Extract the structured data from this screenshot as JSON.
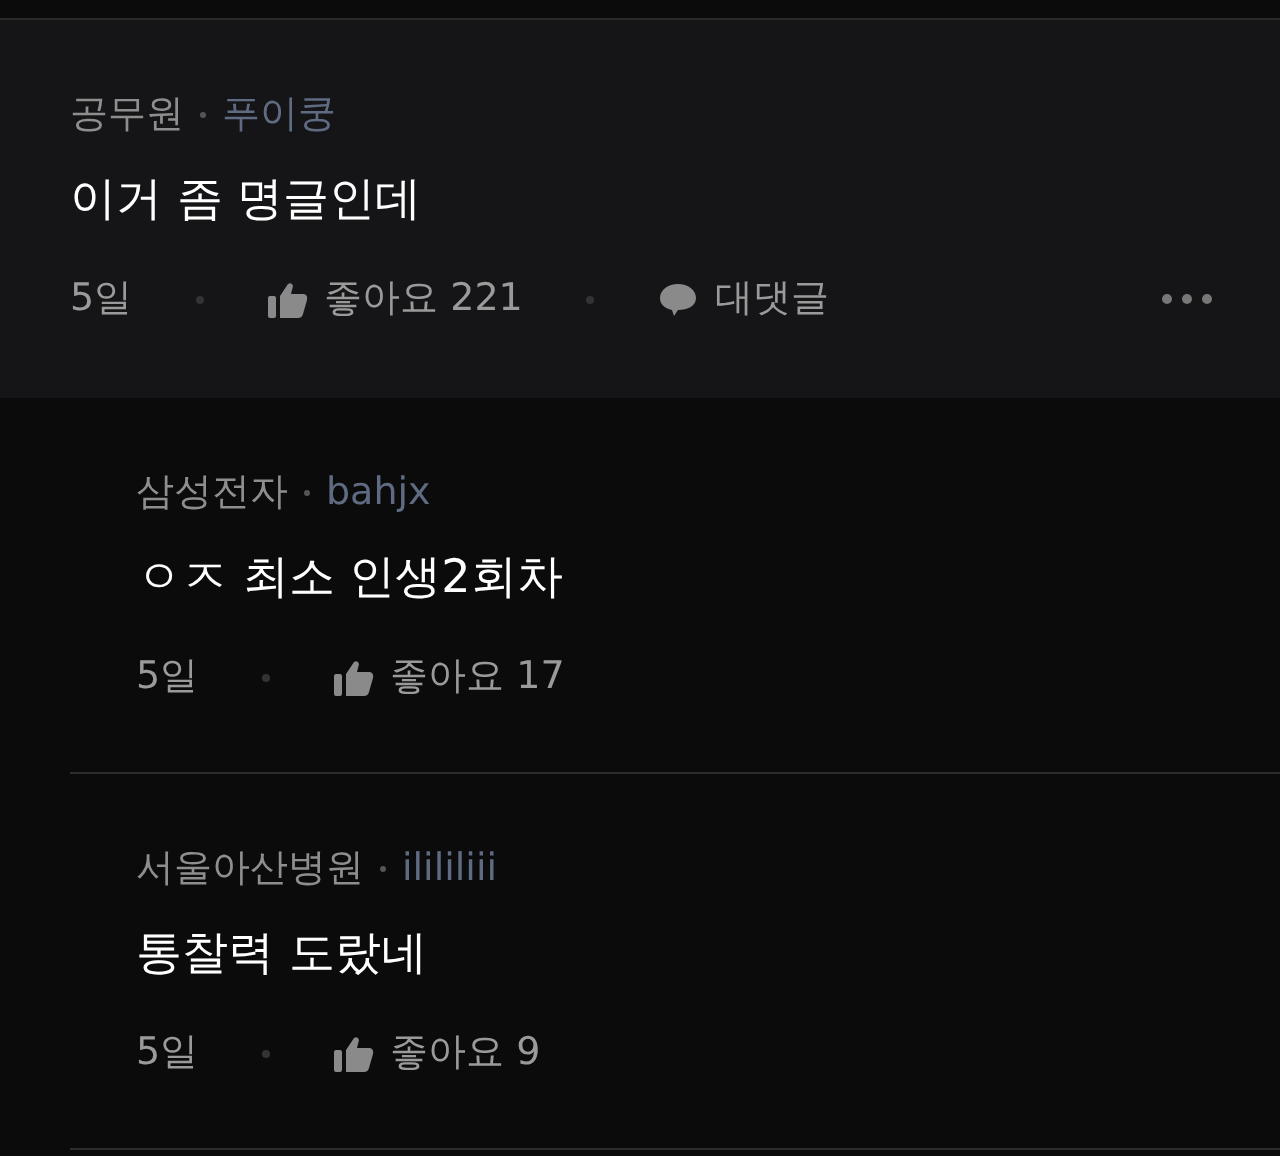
{
  "comment": {
    "company": "공무원",
    "nickname": "푸이쿵",
    "text": "이거 좀 명글인데",
    "age": "5일",
    "likes": "좋아요 221",
    "reply_label": "대댓글"
  },
  "replies": [
    {
      "company": "삼성전자",
      "nickname": "bahjx",
      "text": "ㅇㅈ 최소 인생2회차",
      "age": "5일",
      "likes": "좋아요 17"
    },
    {
      "company": "서울아산병원",
      "nickname": "ilililiii",
      "text": "통찰력 도랐네",
      "age": "5일",
      "likes": "좋아요 9"
    }
  ]
}
